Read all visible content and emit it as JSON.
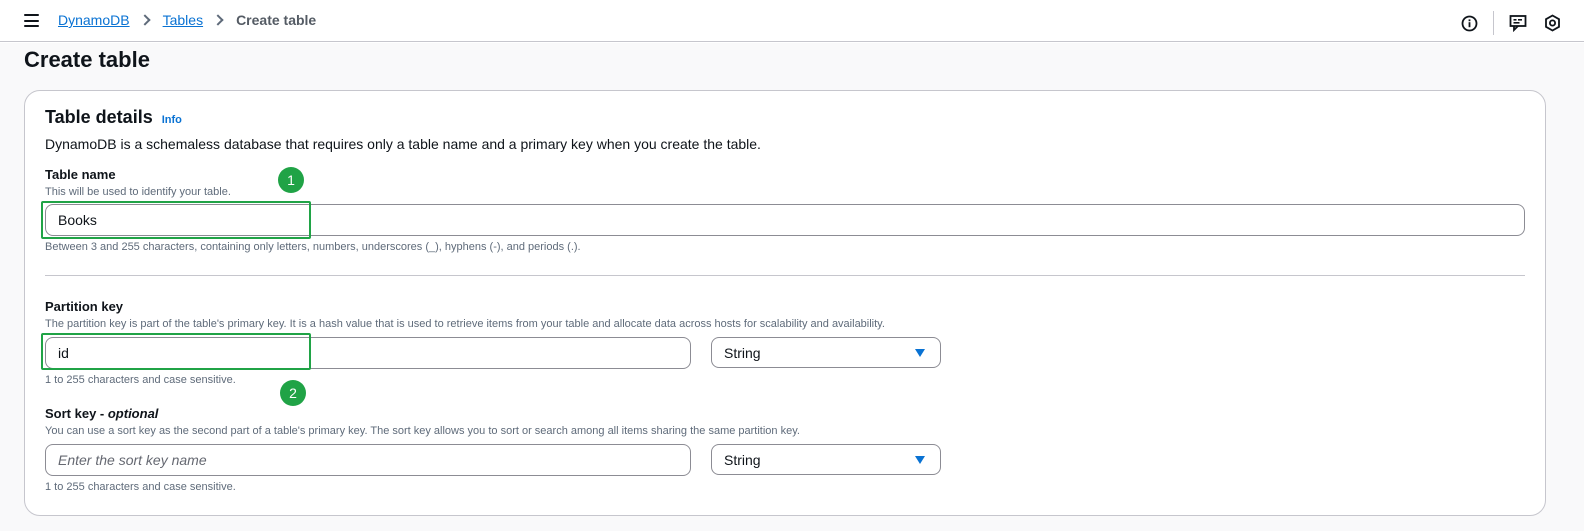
{
  "breadcrumb": {
    "root": "DynamoDB",
    "section": "Tables",
    "current": "Create table"
  },
  "page": {
    "title": "Create table"
  },
  "table_details": {
    "title": "Table details",
    "info_label": "Info",
    "description": "DynamoDB is a schemaless database that requires only a table name and a primary key when you create the table."
  },
  "table_name": {
    "label": "Table name",
    "hint": "This will be used to identify your table.",
    "value": "Books",
    "constraint": "Between 3 and 255 characters, containing only letters, numbers, underscores (_), hyphens (-), and periods (.)."
  },
  "partition_key": {
    "label": "Partition key",
    "hint": "The partition key is part of the table's primary key. It is a hash value that is used to retrieve items from your table and allocate data across hosts for scalability and availability.",
    "value": "id",
    "type": "String",
    "constraint": "1 to 255 characters and case sensitive."
  },
  "sort_key": {
    "label": "Sort key - ",
    "label_optional": "optional",
    "hint": "You can use a sort key as the second part of a table's primary key. The sort key allows you to sort or search among all items sharing the same partition key.",
    "placeholder": "Enter the sort key name",
    "type": "String",
    "constraint": "1 to 255 characters and case sensitive."
  },
  "annotations": {
    "step1": "1",
    "step2": "2",
    "color": "#20a346"
  },
  "colors": {
    "link": "#0972d3",
    "border": "#8c8c94",
    "text": "#0f141a",
    "hint": "#5f6b7a"
  }
}
